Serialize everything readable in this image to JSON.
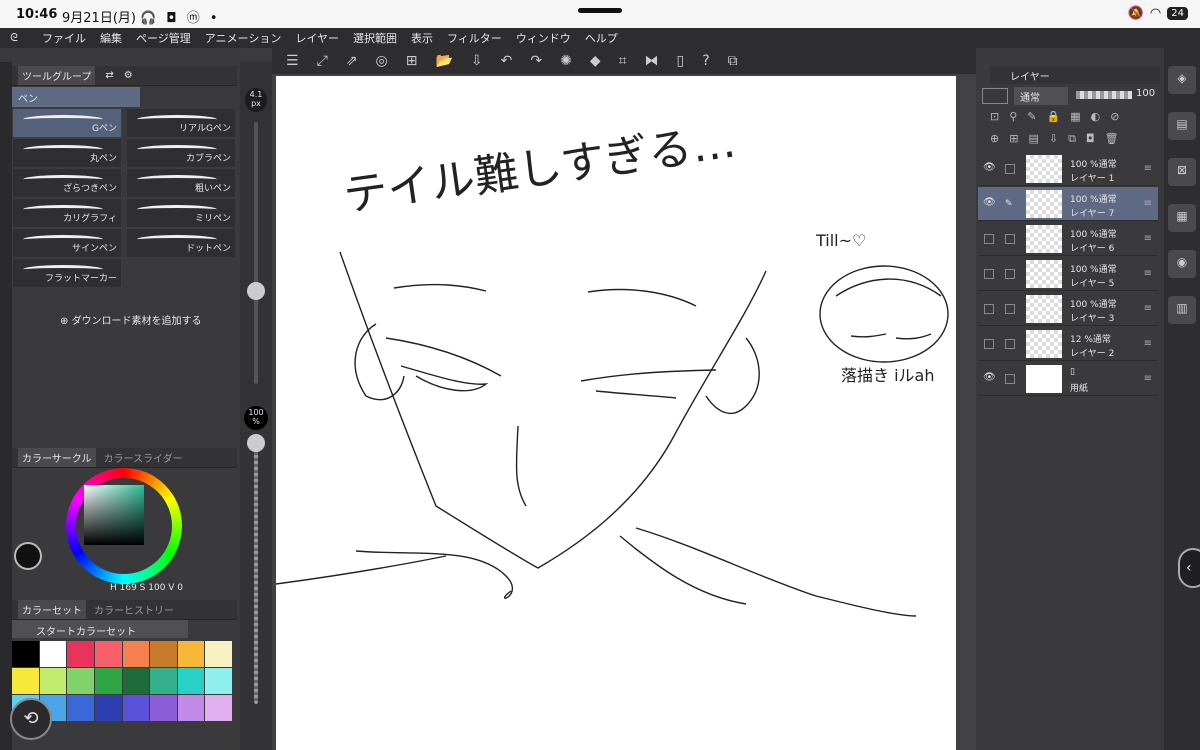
{
  "status": {
    "time": "10:46",
    "date": "9月21日(月)",
    "indicators": "🎧 ◘ ⓜ •",
    "battery": "24"
  },
  "menu": [
    "ファイル",
    "編集",
    "ページ管理",
    "アニメーション",
    "レイヤー",
    "選択範囲",
    "表示",
    "フィルター",
    "ウィンドウ",
    "ヘルプ"
  ],
  "tool": {
    "group_tab": "ツールグループ",
    "sub_tool": "ペン",
    "brushes": [
      "Gペン",
      "リアルGペン",
      "丸ペン",
      "カブラペン",
      "ざらつきペン",
      "粗いペン",
      "カリグラフィ",
      "ミリペン",
      "サインペン",
      "ドットペン",
      "フラットマーカー"
    ],
    "add_material": "ダウンロード素材を追加する",
    "size": "4.1 px",
    "opacity": "100 %"
  },
  "color": {
    "tab_circle": "カラーサークル",
    "tab_slider": "カラースライダー",
    "hsv": "H 169 S 100 V 0",
    "accent": "#2fbf99"
  },
  "colorset": {
    "tab_set": "カラーセット",
    "tab_history": "カラーヒストリー",
    "selected": "スタートカラーセット",
    "swatches": [
      "#000000",
      "#ffffff",
      "#e8345a",
      "#f75f6b",
      "#f6804d",
      "#c77a2a",
      "#f7b83a",
      "#f8f1c2",
      "#f6e93a",
      "#c2ec6e",
      "#7fd36a",
      "#2ea644",
      "#1f6b3a",
      "#35b08c",
      "#28d0c7",
      "#8ff0f0",
      "#5fd0f0",
      "#4aa6e8",
      "#3b68d8",
      "#2d3fb0",
      "#5a52d8",
      "#8b5ed8",
      "#c08be8",
      "#e0b0f0"
    ]
  },
  "layers": {
    "tab": "レイヤー",
    "blend": "通常",
    "opacity": "100",
    "items": [
      {
        "percent": "100 %通常",
        "name": "レイヤー 1",
        "selected": false,
        "visible": true
      },
      {
        "percent": "100 %通常",
        "name": "レイヤー 7",
        "selected": true,
        "visible": true
      },
      {
        "percent": "100 %通常",
        "name": "レイヤー 6",
        "selected": false,
        "visible": false
      },
      {
        "percent": "100 %通常",
        "name": "レイヤー 5",
        "selected": false,
        "visible": false
      },
      {
        "percent": "100 %通常",
        "name": "レイヤー 3",
        "selected": false,
        "visible": false
      },
      {
        "percent": "12 %通常",
        "name": "レイヤー 2",
        "selected": false,
        "visible": false
      },
      {
        "percent": "",
        "name": "用紙",
        "selected": false,
        "visible": true
      }
    ]
  },
  "canvas": {
    "caption": "テイル難しすぎる…",
    "signature_top": "Till~♡",
    "signature_bottom": "落描き iルah"
  }
}
